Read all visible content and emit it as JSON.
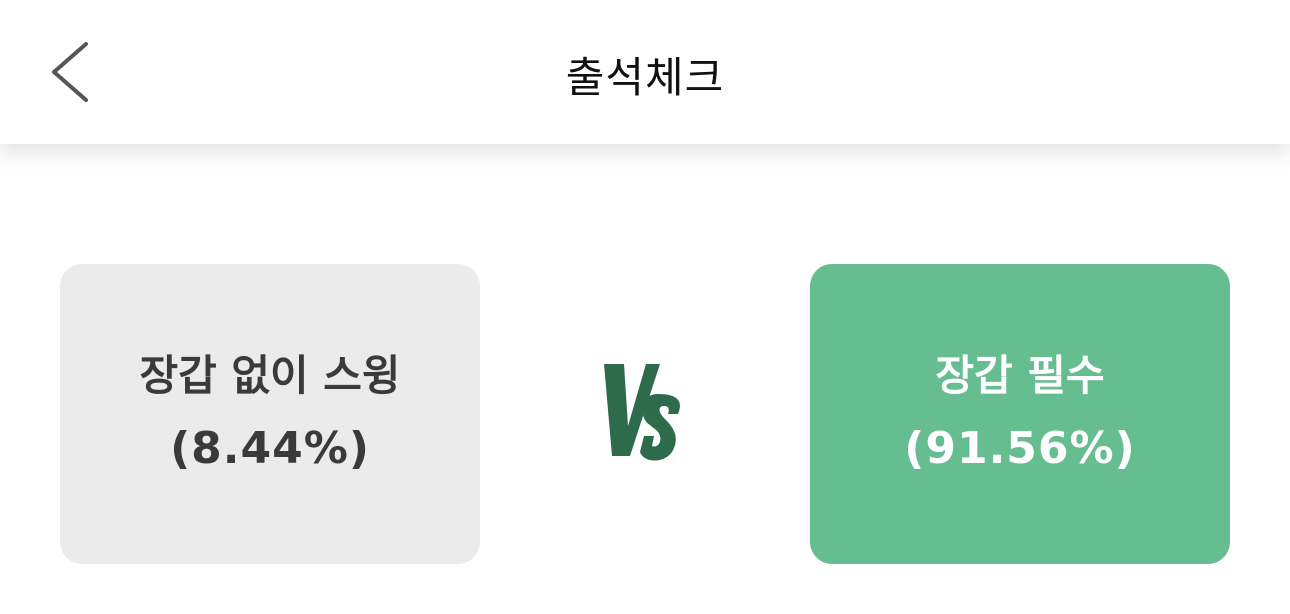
{
  "header": {
    "title": "출석체크",
    "back_icon": "chevron-left-icon"
  },
  "options": {
    "left": {
      "label": "장갑 없이 스윙",
      "percent": "(8.44%)",
      "share": 8.44,
      "color": "#ebebeb",
      "text_color": "#3a3a3a"
    },
    "right": {
      "label": "장갑 필수",
      "percent": "(91.56%)",
      "share": 91.56,
      "color": "#66bd90",
      "text_color": "#ffffff"
    }
  },
  "vs": {
    "text": "VS",
    "color": "#2e6b4b"
  }
}
